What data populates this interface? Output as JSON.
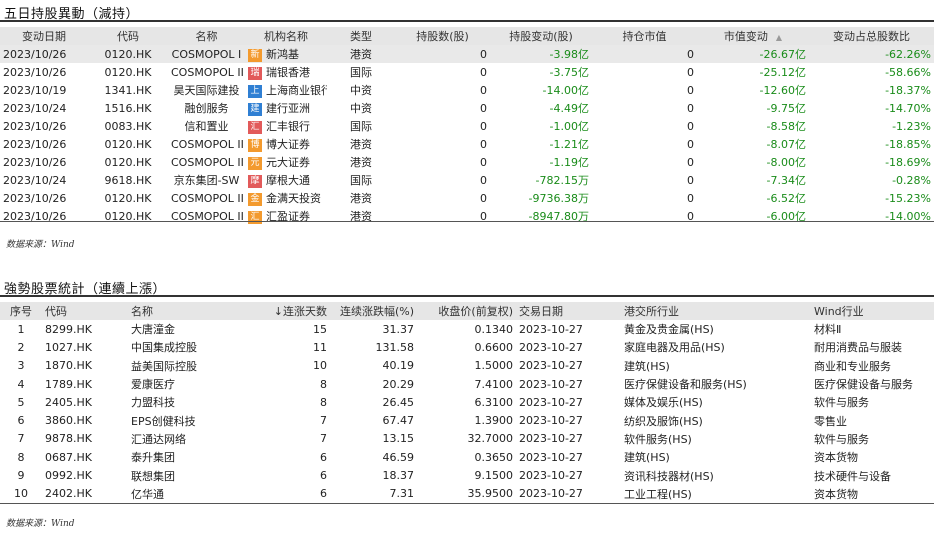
{
  "table1": {
    "title": "五日持股異動（減持）",
    "headers": [
      "变动日期",
      "代码",
      "名称",
      "机构名称",
      "类型",
      "持股数(股)",
      "持股变动(股)",
      "持仓市值",
      "市值变动",
      "变动占总股数比"
    ],
    "sort_indicator": "▲",
    "rows": [
      {
        "date": "2023/10/26",
        "code": "0120.HK",
        "name": "COSMOPOL I",
        "badge": "新",
        "badge_color": "#f39a2e",
        "inst": "新鸿基",
        "type": "港资",
        "shares": "0",
        "change": "-3.98亿",
        "mv": "0",
        "mv_change": "-26.67亿",
        "pct": "-62.26%"
      },
      {
        "date": "2023/10/26",
        "code": "0120.HK",
        "name": "COSMOPOL II",
        "badge": "瑞",
        "badge_color": "#e25a5a",
        "inst": "瑞银香港",
        "type": "国际",
        "shares": "0",
        "change": "-3.75亿",
        "mv": "0",
        "mv_change": "-25.12亿",
        "pct": "-58.66%"
      },
      {
        "date": "2023/10/19",
        "code": "1341.HK",
        "name": "昊天国际建投",
        "badge": "上",
        "badge_color": "#2f7fd3",
        "inst": "上海商业银行",
        "type": "中资",
        "shares": "0",
        "change": "-14.00亿",
        "mv": "0",
        "mv_change": "-12.60亿",
        "pct": "-18.37%"
      },
      {
        "date": "2023/10/24",
        "code": "1516.HK",
        "name": "融创服务",
        "badge": "建",
        "badge_color": "#2f7fd3",
        "inst": "建行亚洲",
        "type": "中资",
        "shares": "0",
        "change": "-4.49亿",
        "mv": "0",
        "mv_change": "-9.75亿",
        "pct": "-14.70%"
      },
      {
        "date": "2023/10/26",
        "code": "0083.HK",
        "name": "信和置业",
        "badge": "汇",
        "badge_color": "#e25a5a",
        "inst": "汇丰银行",
        "type": "国际",
        "shares": "0",
        "change": "-1.00亿",
        "mv": "0",
        "mv_change": "-8.58亿",
        "pct": "-1.23%"
      },
      {
        "date": "2023/10/26",
        "code": "0120.HK",
        "name": "COSMOPOL II",
        "badge": "博",
        "badge_color": "#f39a2e",
        "inst": "博大证券",
        "type": "港资",
        "shares": "0",
        "change": "-1.21亿",
        "mv": "0",
        "mv_change": "-8.07亿",
        "pct": "-18.85%"
      },
      {
        "date": "2023/10/26",
        "code": "0120.HK",
        "name": "COSMOPOL II",
        "badge": "元",
        "badge_color": "#f39a2e",
        "inst": "元大证券",
        "type": "港资",
        "shares": "0",
        "change": "-1.19亿",
        "mv": "0",
        "mv_change": "-8.00亿",
        "pct": "-18.69%"
      },
      {
        "date": "2023/10/24",
        "code": "9618.HK",
        "name": "京东集团-SW",
        "badge": "摩",
        "badge_color": "#e25a5a",
        "inst": "摩根大通",
        "type": "国际",
        "shares": "0",
        "change": "-782.15万",
        "mv": "0",
        "mv_change": "-7.34亿",
        "pct": "-0.28%"
      },
      {
        "date": "2023/10/26",
        "code": "0120.HK",
        "name": "COSMOPOL II",
        "badge": "金",
        "badge_color": "#f39a2e",
        "inst": "金满天投资",
        "type": "港资",
        "shares": "0",
        "change": "-9736.38万",
        "mv": "0",
        "mv_change": "-6.52亿",
        "pct": "-15.23%"
      },
      {
        "date": "2023/10/26",
        "code": "0120.HK",
        "name": "COSMOPOL II",
        "badge": "汇",
        "badge_color": "#f39a2e",
        "inst": "汇盈证券",
        "type": "港资",
        "shares": "0",
        "change": "-8947.80万",
        "mv": "0",
        "mv_change": "-6.00亿",
        "pct": "-14.00%"
      }
    ]
  },
  "source1": "数据来源：Wind",
  "table2": {
    "title": "強勢股票統計（連續上漲）",
    "headers": [
      "序号",
      "代码",
      "名称",
      "↓连涨天数",
      "连续涨跌幅(%)",
      "收盘价(前复权)",
      "交易日期",
      "港交所行业",
      "Wind行业"
    ],
    "rows": [
      {
        "no": "1",
        "code": "8299.HK",
        "name": "大唐潼金",
        "days": "15",
        "pct": "31.37",
        "close": "0.1340",
        "date": "2023-10-27",
        "hkex": "黄金及贵金属(HS)",
        "wind": "材料Ⅱ"
      },
      {
        "no": "2",
        "code": "1027.HK",
        "name": "中国集成控股",
        "days": "11",
        "pct": "131.58",
        "close": "0.6600",
        "date": "2023-10-27",
        "hkex": "家庭电器及用品(HS)",
        "wind": "耐用消费品与服装"
      },
      {
        "no": "3",
        "code": "1870.HK",
        "name": "益美国际控股",
        "days": "10",
        "pct": "40.19",
        "close": "1.5000",
        "date": "2023-10-27",
        "hkex": "建筑(HS)",
        "wind": "商业和专业服务"
      },
      {
        "no": "4",
        "code": "1789.HK",
        "name": "爱康医疗",
        "days": "8",
        "pct": "20.29",
        "close": "7.4100",
        "date": "2023-10-27",
        "hkex": "医疗保健设备和服务(HS)",
        "wind": "医疗保健设备与服务"
      },
      {
        "no": "5",
        "code": "2405.HK",
        "name": "力盟科技",
        "days": "8",
        "pct": "26.45",
        "close": "6.3100",
        "date": "2023-10-27",
        "hkex": "媒体及娱乐(HS)",
        "wind": "软件与服务"
      },
      {
        "no": "6",
        "code": "3860.HK",
        "name": "EPS创健科技",
        "days": "7",
        "pct": "67.47",
        "close": "1.3900",
        "date": "2023-10-27",
        "hkex": "纺织及服饰(HS)",
        "wind": "零售业"
      },
      {
        "no": "7",
        "code": "9878.HK",
        "name": "汇通达网络",
        "days": "7",
        "pct": "13.15",
        "close": "32.7000",
        "date": "2023-10-27",
        "hkex": "软件服务(HS)",
        "wind": "软件与服务"
      },
      {
        "no": "8",
        "code": "0687.HK",
        "name": "泰升集团",
        "days": "6",
        "pct": "46.59",
        "close": "0.3650",
        "date": "2023-10-27",
        "hkex": "建筑(HS)",
        "wind": "资本货物"
      },
      {
        "no": "9",
        "code": "0992.HK",
        "name": "联想集团",
        "days": "6",
        "pct": "18.37",
        "close": "9.1500",
        "date": "2023-10-27",
        "hkex": "资讯科技器材(HS)",
        "wind": "技术硬件与设备"
      },
      {
        "no": "10",
        "code": "2402.HK",
        "name": "亿华通",
        "days": "6",
        "pct": "7.31",
        "close": "35.9500",
        "date": "2023-10-27",
        "hkex": "工业工程(HS)",
        "wind": "资本货物"
      }
    ]
  },
  "source2": "数据来源：Wind"
}
